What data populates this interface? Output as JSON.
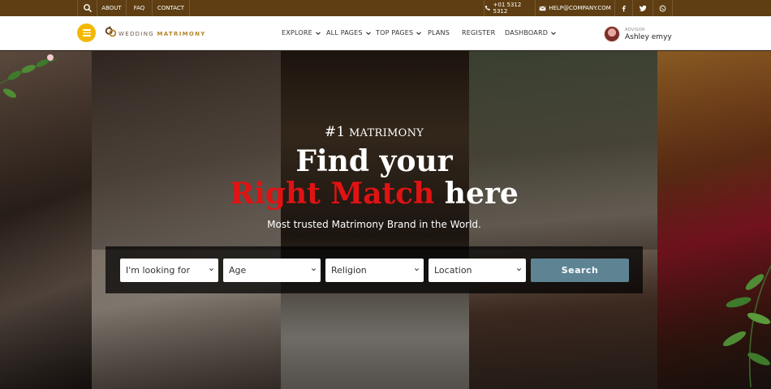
{
  "topbar": {
    "links": [
      "ABOUT",
      "FAQ",
      "CONTACT"
    ],
    "phone": "+01 5312 5312",
    "email": "HELP@COMPANY.COM",
    "icons": [
      "search-icon",
      "phone-icon",
      "mail-icon",
      "facebook-icon",
      "twitter-icon",
      "whatsapp-icon"
    ]
  },
  "brand": {
    "prefix": "WEDDING",
    "highlight": "MATRIMONY",
    "accent": "#f4b800",
    "topbar_bg": "#5e3e12"
  },
  "nav": {
    "items": [
      {
        "label": "EXPLORE",
        "dropdown": true
      },
      {
        "label": "ALL PAGES",
        "dropdown": true
      },
      {
        "label": "TOP PAGES",
        "dropdown": true
      },
      {
        "label": "PLANS",
        "dropdown": false
      },
      {
        "label": "REGISTER",
        "dropdown": false
      },
      {
        "label": "DASHBOARD",
        "dropdown": true
      }
    ]
  },
  "user": {
    "role": "ADVISOR",
    "name": "Ashley emyy"
  },
  "hero": {
    "eyebrow_num": "#1",
    "eyebrow_text": "MATRIMONY",
    "line1": "Find your",
    "line2_red": "Right Match",
    "line2_white": "here",
    "highlight_color": "#e01313",
    "subtitle": "Most trusted Matrimony Brand in the World."
  },
  "search": {
    "fields": [
      {
        "value": "I'm looking for"
      },
      {
        "value": "Age"
      },
      {
        "value": "Religion"
      },
      {
        "value": "Location"
      }
    ],
    "button_label": "Search",
    "button_color": "#5e8494"
  }
}
